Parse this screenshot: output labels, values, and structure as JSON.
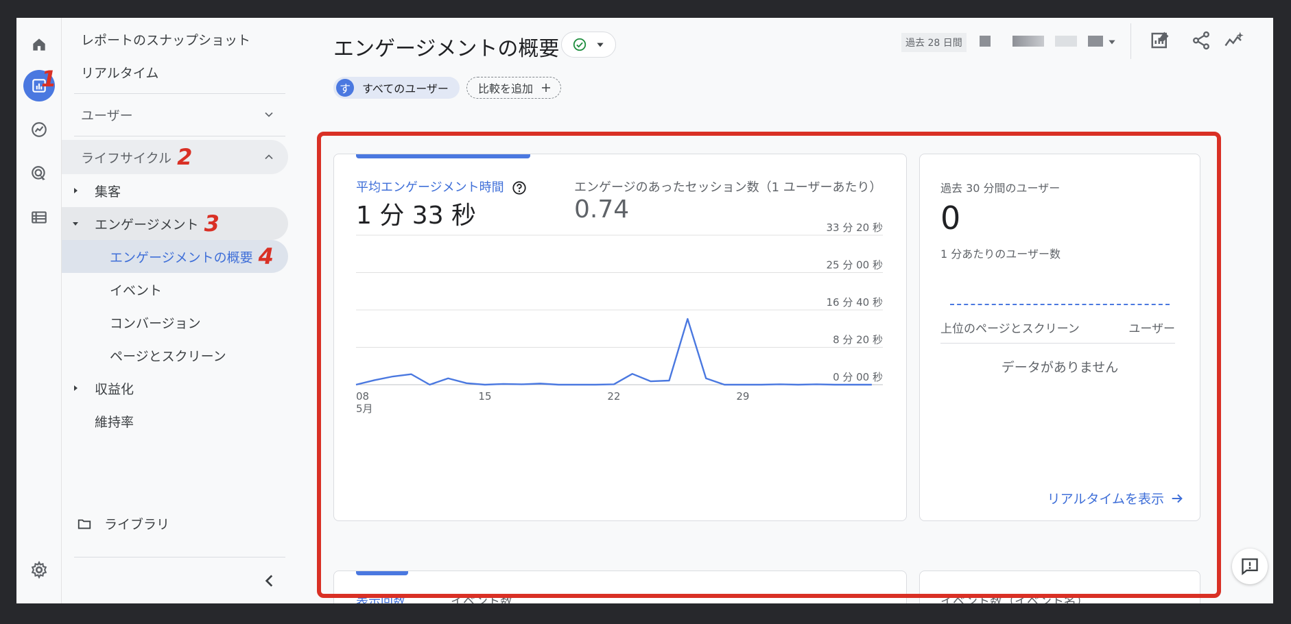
{
  "rail": {
    "items": [
      {
        "icon": "home-icon"
      },
      {
        "icon": "reports-icon",
        "active": true
      },
      {
        "icon": "explore-icon"
      },
      {
        "icon": "advertising-icon"
      },
      {
        "icon": "configure-icon"
      }
    ],
    "settings_icon": "gear-icon",
    "badge": "1"
  },
  "sidebar": {
    "snapshot": "レポートのスナップショット",
    "realtime": "リアルタイム",
    "user_section": "ユーザー",
    "lifecycle_section": "ライフサイクル",
    "lifecycle_badge": "2",
    "acquisition": "集客",
    "engagement": "エンゲージメント",
    "engagement_badge": "3",
    "engagement_overview": "エンゲージメントの概要",
    "overview_badge": "4",
    "events": "イベント",
    "conversions": "コンバージョン",
    "pages_screens": "ページとスクリーン",
    "monetization": "収益化",
    "retention": "維持率",
    "library": "ライブラリ"
  },
  "header": {
    "title": "エンゲージメントの概要",
    "date_range": "過去 28 日間",
    "user_chip_initial": "す",
    "user_chip_label": "すべてのユーザー",
    "add_comparison": "比較を追加"
  },
  "main_card": {
    "metric1_label": "平均エンゲージメント時間",
    "metric1_value": "1 分 33 秒",
    "metric2_label": "エンゲージのあったセッション数（1 ユーザーあたり）",
    "metric2_value": "0.74"
  },
  "realtime_card": {
    "label": "過去 30 分間のユーザー",
    "value": "0",
    "per_minute": "1 分あたりのユーザー数",
    "col_pages": "上位のページとスクリーン",
    "col_users": "ユーザー",
    "empty": "データがありません",
    "link": "リアルタイムを表示"
  },
  "bottom_cards": {
    "tab1": "表示回数",
    "tab2": "イベント数",
    "right_title": "イベント数（イベント名）"
  },
  "chart_data": {
    "type": "line",
    "x": [
      8,
      9,
      10,
      11,
      12,
      13,
      14,
      15,
      16,
      17,
      18,
      19,
      20,
      21,
      22,
      23,
      24,
      25,
      26,
      27,
      28,
      29,
      30,
      31,
      32,
      33,
      34,
      35,
      36
    ],
    "x_tick_labels": [
      "08",
      "15",
      "22",
      "29"
    ],
    "x_tick_values": [
      8,
      15,
      22,
      29
    ],
    "x_month_label": "5月",
    "series": [
      {
        "values": [
          0,
          60,
          110,
          140,
          0,
          85,
          20,
          0,
          10,
          5,
          15,
          0,
          0,
          0,
          5,
          145,
          45,
          55,
          880,
          85,
          0,
          0,
          0,
          5,
          0,
          5,
          0,
          0,
          0
        ]
      }
    ],
    "y_tick_labels": [
      "0 分 00 秒",
      "8 分 20 秒",
      "16 分 40 秒",
      "25 分 00 秒",
      "33 分 20 秒"
    ],
    "y_tick_values": [
      0,
      500,
      1000,
      1500,
      2000
    ],
    "ylim": [
      0,
      2000
    ],
    "color": "#4a78e0"
  }
}
